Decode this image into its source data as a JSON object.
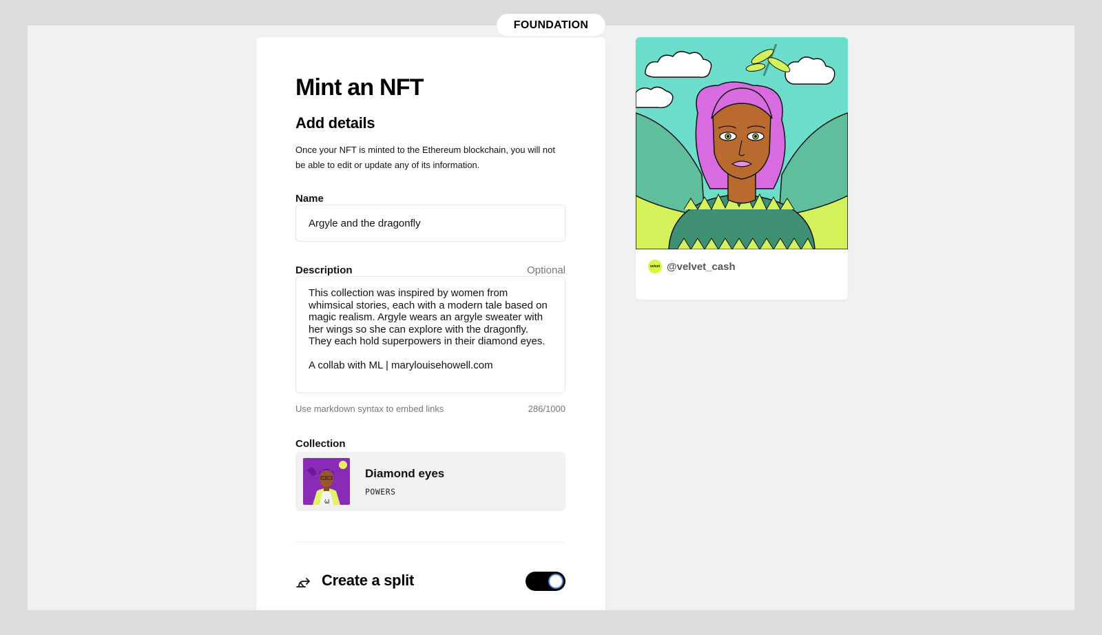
{
  "brand": {
    "name": "FOUNDATION"
  },
  "form": {
    "title": "Mint an NFT",
    "subtitle": "Add details",
    "notice": "Once your NFT is minted to the Ethereum blockchain, you will not be able to edit or update any of its information.",
    "name_label": "Name",
    "name_value": "Argyle and the dragonfly",
    "description_label": "Description",
    "description_optional": "Optional",
    "description_paragraph1": "This collection was inspired by women from whimsical stories, each with a modern tale based on magic realism. Argyle wears an argyle sweater with her wings so she can explore with the dragonfly. They each hold superpowers in their diamond eyes.",
    "description_paragraph2": "A collab with ML | marylouisehowell.com",
    "description_hint": "Use markdown syntax to embed links",
    "description_count": "286/1000",
    "collection_label": "Collection",
    "collection_name": "Diamond eyes",
    "collection_symbol": "POWERS",
    "split_label": "Create a split",
    "split_enabled": true
  },
  "preview": {
    "creator_handle": "@velvet_cash",
    "creator_avatar_text": "velvet"
  },
  "colors": {
    "sky": "#6cdccb",
    "hair": "#d86be0",
    "skin": "#b96a2e",
    "wings_green": "#5fbf9d",
    "wings_lime": "#d4f25a",
    "sweater": "#3f8f72",
    "toggle_on": "#000000",
    "collection_bg": "#8a2bb8"
  },
  "icons": [
    "split-arrow-icon",
    "dragonfly-icon"
  ]
}
